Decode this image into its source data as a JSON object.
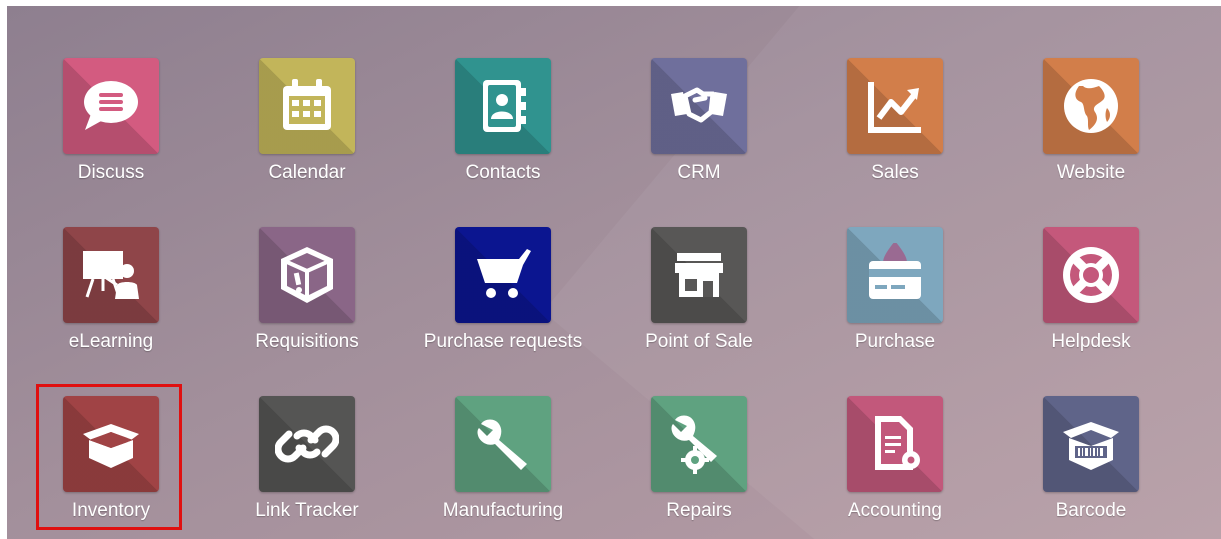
{
  "apps": {
    "discuss": {
      "label": "Discuss",
      "icon": "chat-bubble-icon",
      "color": "#d35b80"
    },
    "calendar": {
      "label": "Calendar",
      "icon": "calendar-icon",
      "color": "#c2b55a"
    },
    "contacts": {
      "label": "Contacts",
      "icon": "address-book-icon",
      "color": "#30938f"
    },
    "crm": {
      "label": "CRM",
      "icon": "handshake-icon",
      "color": "#6f6f9c"
    },
    "sales": {
      "label": "Sales",
      "icon": "line-chart-icon",
      "color": "#d27e4a"
    },
    "website": {
      "label": "Website",
      "icon": "globe-icon",
      "color": "#d27e4a"
    },
    "elearning": {
      "label": "eLearning",
      "icon": "presentation-board-icon",
      "color": "#8f4549"
    },
    "requisitions": {
      "label": "Requisitions",
      "icon": "box-exclamation-icon",
      "color": "#8a6687"
    },
    "purchase_requests": {
      "label": "Purchase requests",
      "icon": "shopping-cart-icon",
      "color": "#0b1590"
    },
    "point_of_sale": {
      "label": "Point of Sale",
      "icon": "storefront-icon",
      "color": "#585756"
    },
    "purchase": {
      "label": "Purchase",
      "icon": "credit-card-icon",
      "color": "#7ea7be"
    },
    "helpdesk": {
      "label": "Helpdesk",
      "icon": "lifebuoy-icon",
      "color": "#c4587b"
    },
    "inventory": {
      "label": "Inventory",
      "icon": "open-box-icon",
      "color": "#a04345"
    },
    "link_tracker": {
      "label": "Link Tracker",
      "icon": "chain-link-icon",
      "color": "#555554"
    },
    "manufacturing": {
      "label": "Manufacturing",
      "icon": "wrench-icon",
      "color": "#5fa280"
    },
    "repairs": {
      "label": "Repairs",
      "icon": "wrench-gear-icon",
      "color": "#5fa280"
    },
    "accounting": {
      "label": "Accounting",
      "icon": "document-gear-icon",
      "color": "#c2587b"
    },
    "barcode": {
      "label": "Barcode",
      "icon": "barcode-box-icon",
      "color": "#5f6489"
    }
  },
  "highlight_color": "#e01010"
}
